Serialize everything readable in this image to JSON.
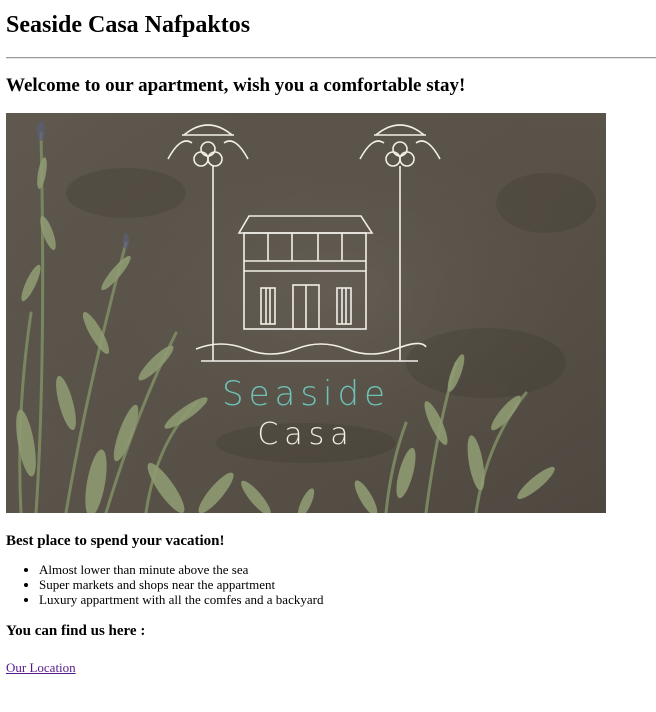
{
  "header": {
    "title": "Seaside Casa Nafpaktos"
  },
  "welcome": {
    "text": "Welcome to our apartment, wish you a comfortable stay!"
  },
  "hero": {
    "logo_line1": "Seaside",
    "logo_line2": "Casa",
    "colors": {
      "wall": "#5d564c",
      "logo_white": "#f2efe9",
      "logo_teal": "#6fc1b6",
      "leaf": "#7d8a63"
    }
  },
  "highlights": {
    "heading": "Best place to spend your vacation!",
    "items": [
      "Almost lower than minute above the sea",
      "Super markets and shops near the appartment",
      "Luxury appartment with all the comfes and a backyard"
    ]
  },
  "location": {
    "heading": "You can find us here :",
    "link_text": "Our Location",
    "link_color": "#551a8b"
  }
}
